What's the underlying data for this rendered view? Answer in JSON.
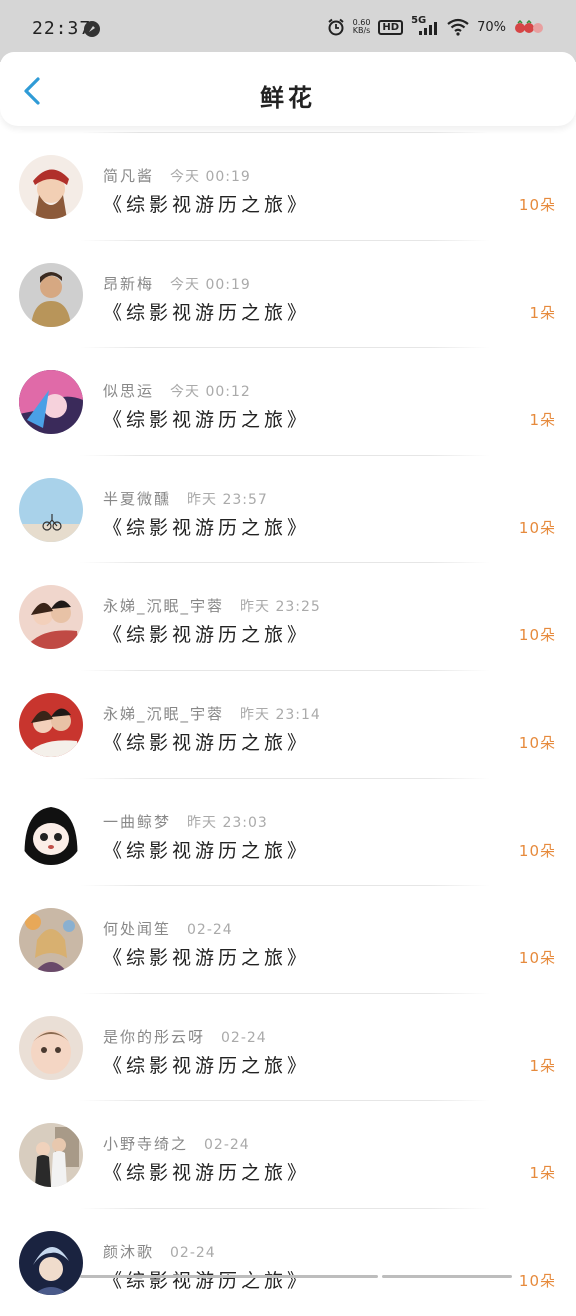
{
  "status_bar": {
    "time": "22:37",
    "net_speed_value": "0.60",
    "net_speed_unit": "KB/s",
    "hd": "HD",
    "network": "5G",
    "battery": "70%"
  },
  "header": {
    "title": "鲜花",
    "back_icon": "chevron-left-icon"
  },
  "colors": {
    "accent": "#e68a3c",
    "back_arrow": "#2f9bd6"
  },
  "records": [
    {
      "name": "简凡酱",
      "time": "今天 00:19",
      "book": "《综影视游历之旅》",
      "flowers": "10朵"
    },
    {
      "name": "昂新梅",
      "time": "今天 00:19",
      "book": "《综影视游历之旅》",
      "flowers": "1朵"
    },
    {
      "name": "似思运",
      "time": "今天 00:12",
      "book": "《综影视游历之旅》",
      "flowers": "1朵"
    },
    {
      "name": "半夏微醺",
      "time": "昨天 23:57",
      "book": "《综影视游历之旅》",
      "flowers": "10朵"
    },
    {
      "name": "永娣_沉眠_宇蓉",
      "time": "昨天 23:25",
      "book": "《综影视游历之旅》",
      "flowers": "10朵"
    },
    {
      "name": "永娣_沉眠_宇蓉",
      "time": "昨天 23:14",
      "book": "《综影视游历之旅》",
      "flowers": "10朵"
    },
    {
      "name": "一曲鲸梦",
      "time": "昨天 23:03",
      "book": "《综影视游历之旅》",
      "flowers": "10朵"
    },
    {
      "name": "何处闻笙",
      "time": "02-24",
      "book": "《综影视游历之旅》",
      "flowers": "10朵"
    },
    {
      "name": "是你的彤云呀",
      "time": "02-24",
      "book": "《综影视游历之旅》",
      "flowers": "1朵"
    },
    {
      "name": "小野寺绮之",
      "time": "02-24",
      "book": "《综影视游历之旅》",
      "flowers": "1朵"
    },
    {
      "name": "颜沐歌",
      "time": "02-24",
      "book": "《综影视游历之旅》",
      "flowers": "10朵"
    }
  ]
}
